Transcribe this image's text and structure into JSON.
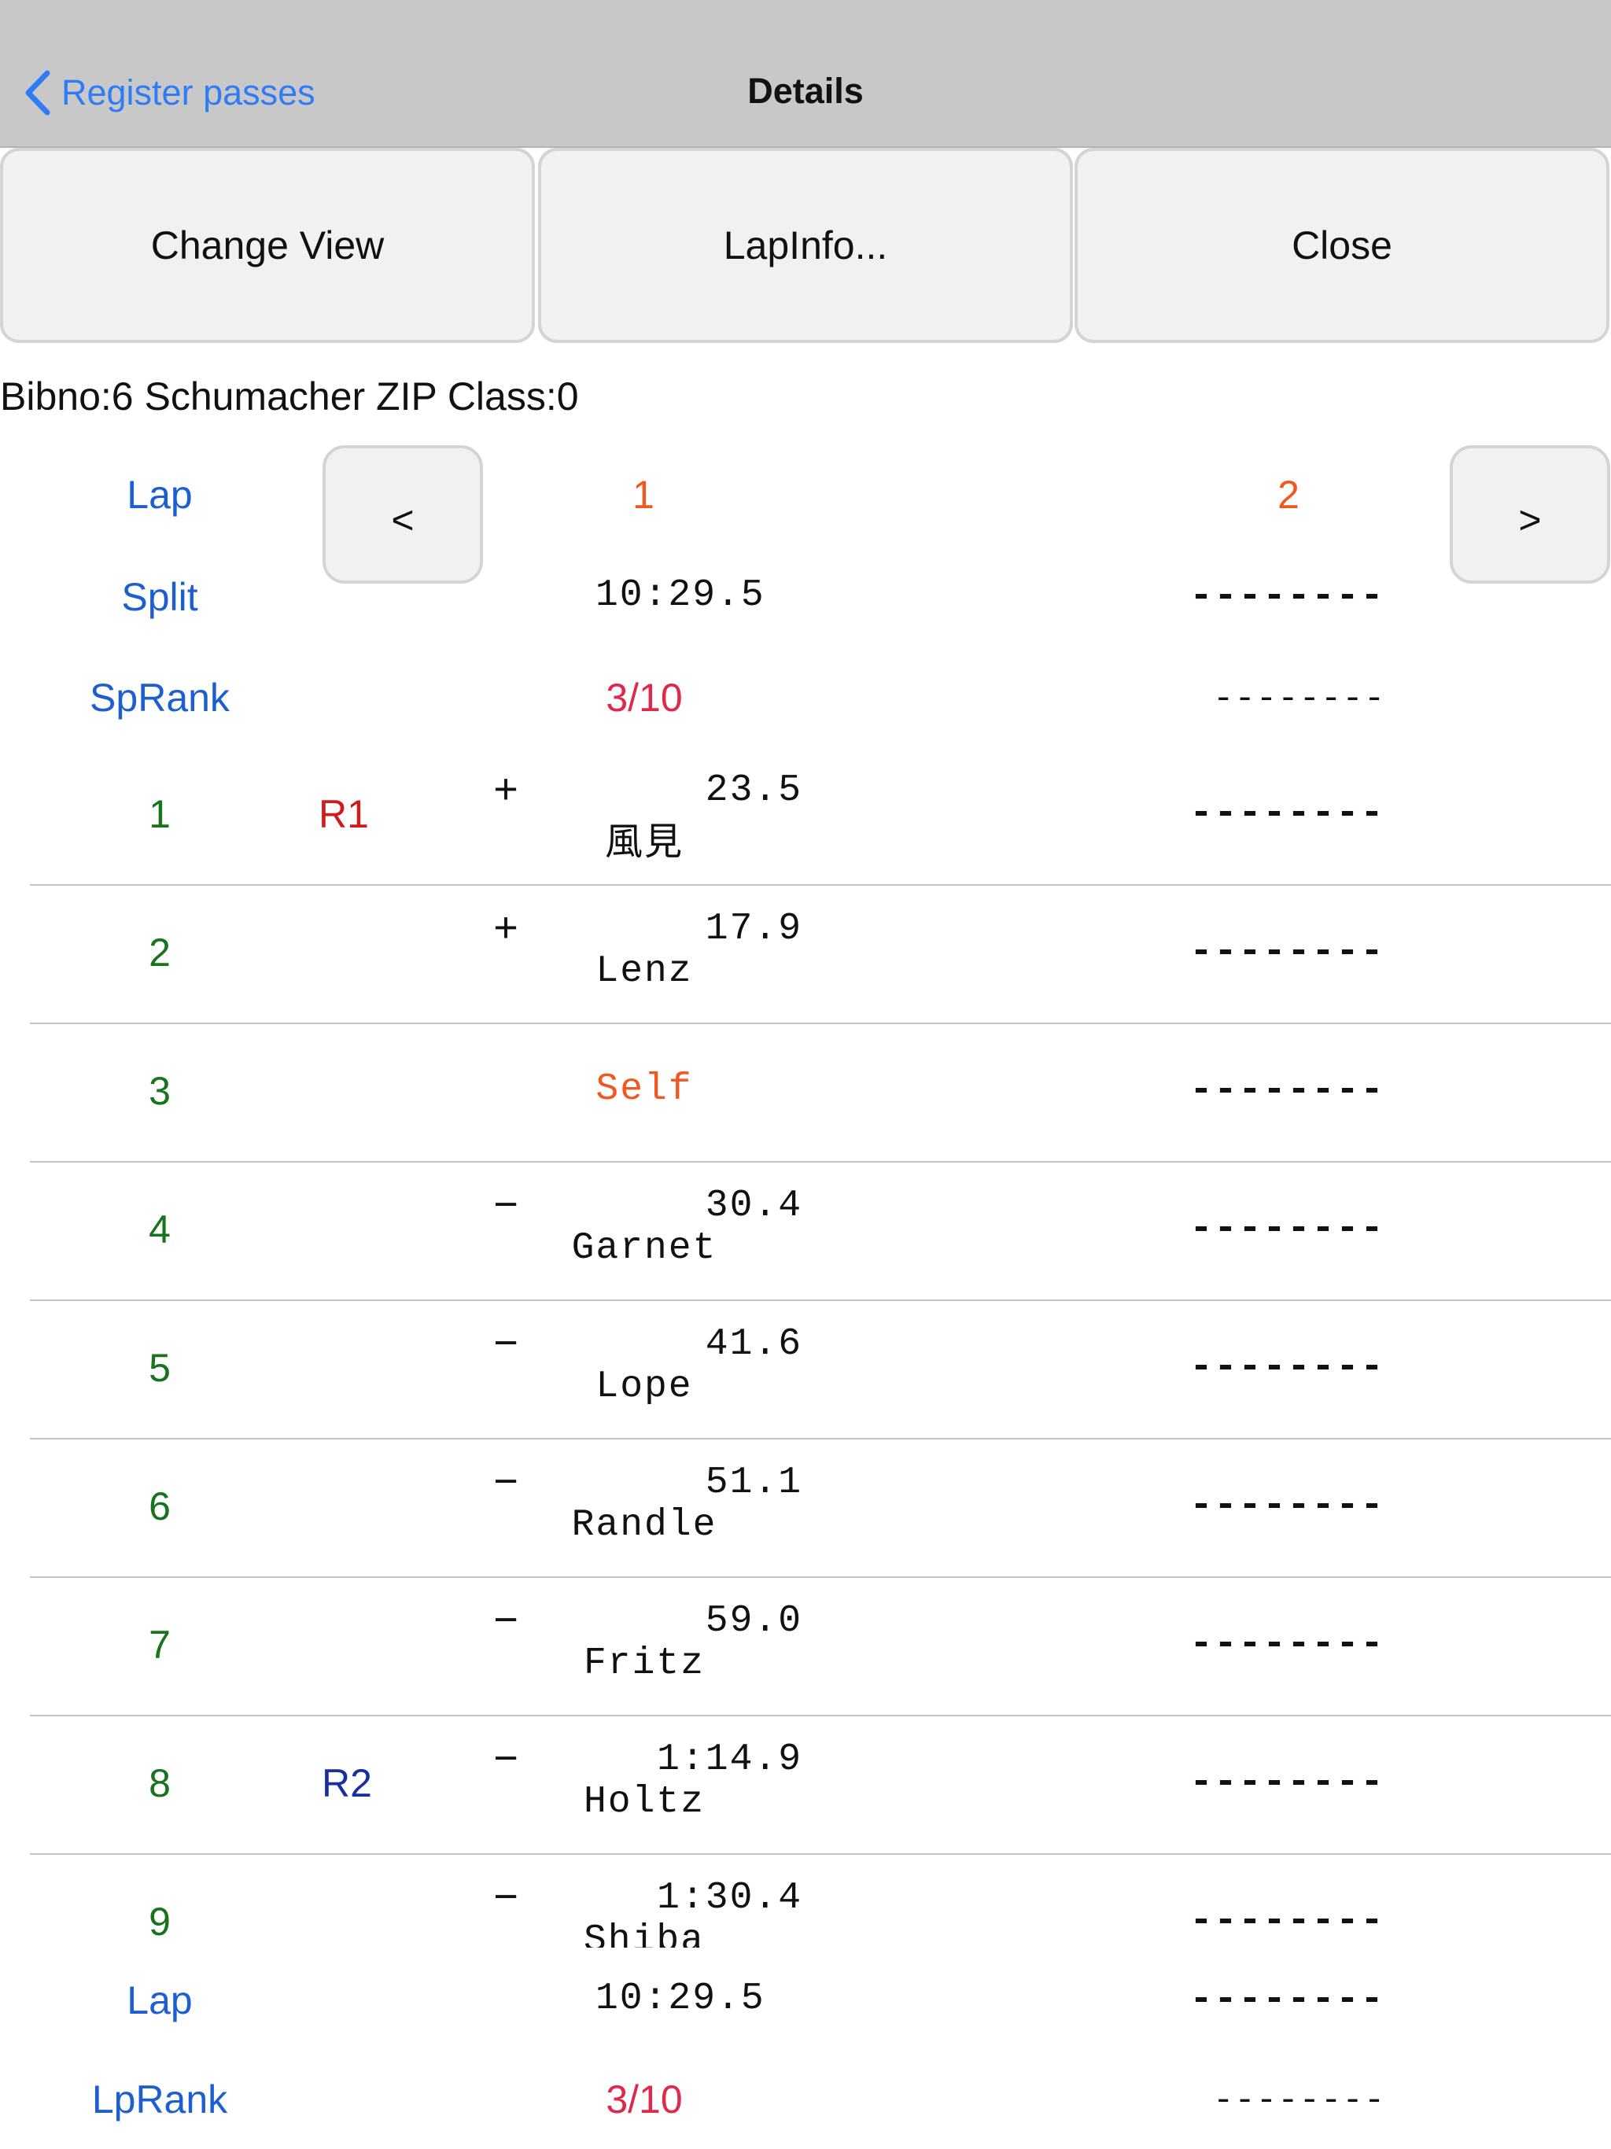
{
  "navbar": {
    "back_label": "Register passes",
    "title": "Details"
  },
  "toolbar": {
    "change_view": "Change View",
    "lap_info": "LapInfo...",
    "close": "Close"
  },
  "info_line": "Bibno:6 Schumacher ZIP Class:0",
  "header": {
    "lap_label": "Lap",
    "prev": "<",
    "next": ">",
    "lap1": "1",
    "lap2": "2",
    "split_label": "Split",
    "split1": "10:29.5",
    "split2": "--------",
    "sprank_label": "SpRank",
    "sprank1": "3/10",
    "sprank2": "--------"
  },
  "rows": [
    {
      "pos": "1",
      "badge": "R1",
      "sign": "+",
      "diff": "23.5",
      "name": "風見",
      "lap2": "--------"
    },
    {
      "pos": "2",
      "badge": "",
      "sign": "+",
      "diff": "17.9",
      "name": "Lenz",
      "lap2": "--------"
    },
    {
      "pos": "3",
      "badge": "",
      "sign": "",
      "diff": "",
      "name": "Self",
      "lap2": "--------"
    },
    {
      "pos": "4",
      "badge": "",
      "sign": "−",
      "diff": "30.4",
      "name": "Garnet",
      "lap2": "--------"
    },
    {
      "pos": "5",
      "badge": "",
      "sign": "−",
      "diff": "41.6",
      "name": "Lope",
      "lap2": "--------"
    },
    {
      "pos": "6",
      "badge": "",
      "sign": "−",
      "diff": "51.1",
      "name": "Randle",
      "lap2": "--------"
    },
    {
      "pos": "7",
      "badge": "",
      "sign": "−",
      "diff": "59.0",
      "name": "Fritz",
      "lap2": "--------"
    },
    {
      "pos": "8",
      "badge": "R2",
      "sign": "−",
      "diff": "1:14.9",
      "name": "Holtz",
      "lap2": "--------"
    },
    {
      "pos": "9",
      "badge": "",
      "sign": "−",
      "diff": "1:30.4",
      "name": "Shiba",
      "lap2": "--------"
    }
  ],
  "footer": {
    "lap_label": "Lap",
    "lap1": "10:29.5",
    "lap2": "--------",
    "lprank_label": "LpRank",
    "lprank1": "3/10",
    "lprank2": "--------"
  },
  "colors": {
    "blue": "#1d5fd0",
    "green": "#17731c",
    "orange": "#f2571f",
    "red": "#e0284a",
    "r1": "#d01c1c",
    "r2": "#1a2f9e"
  }
}
